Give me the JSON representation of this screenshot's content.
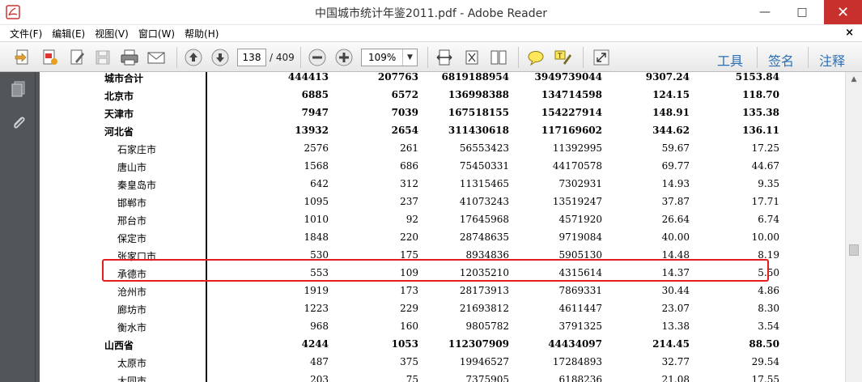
{
  "window": {
    "title": "中国城市统计年鉴2011.pdf - Adobe Reader",
    "minimize": "—",
    "maximize": "□",
    "close": "✕"
  },
  "menu": {
    "items": [
      "文件(F)",
      "编辑(E)",
      "视图(V)",
      "窗口(W)",
      "帮助(H)"
    ],
    "close_doc": "×"
  },
  "toolbar": {
    "page_current": "138",
    "page_total": "/ 409",
    "zoom": "109%",
    "tools_label": "工具",
    "sign_label": "签名",
    "comment_label": "注释",
    "accent_color": "#2a6fb5"
  },
  "table": {
    "rows": [
      {
        "name": "城市合计",
        "bold": true,
        "indent": false,
        "v1": "444413",
        "v2": "207763",
        "v3": "6819188954",
        "v4": "3949739044",
        "v5": "9307.24",
        "v6": "5153.84"
      },
      {
        "name": "北京市",
        "bold": true,
        "indent": false,
        "v1": "6885",
        "v2": "6572",
        "v3": "136998388",
        "v4": "134714598",
        "v5": "124.15",
        "v6": "118.70"
      },
      {
        "name": "天津市",
        "bold": true,
        "indent": false,
        "v1": "7947",
        "v2": "7039",
        "v3": "167518155",
        "v4": "154227914",
        "v5": "148.91",
        "v6": "135.38"
      },
      {
        "name": "河北省",
        "bold": true,
        "indent": false,
        "v1": "13932",
        "v2": "2654",
        "v3": "311430618",
        "v4": "117169602",
        "v5": "344.62",
        "v6": "136.11"
      },
      {
        "name": "石家庄市",
        "bold": false,
        "indent": true,
        "v1": "2576",
        "v2": "261",
        "v3": "56553423",
        "v4": "11392995",
        "v5": "59.67",
        "v6": "17.25"
      },
      {
        "name": "唐山市",
        "bold": false,
        "indent": true,
        "v1": "1568",
        "v2": "686",
        "v3": "75450331",
        "v4": "44170578",
        "v5": "69.77",
        "v6": "44.67"
      },
      {
        "name": "秦皇岛市",
        "bold": false,
        "indent": true,
        "v1": "642",
        "v2": "312",
        "v3": "11315465",
        "v4": "7302931",
        "v5": "14.93",
        "v6": "9.35"
      },
      {
        "name": "邯郸市",
        "bold": false,
        "indent": true,
        "v1": "1095",
        "v2": "237",
        "v3": "41073243",
        "v4": "13519247",
        "v5": "37.87",
        "v6": "17.71"
      },
      {
        "name": "邢台市",
        "bold": false,
        "indent": true,
        "v1": "1010",
        "v2": "92",
        "v3": "17645968",
        "v4": "4571920",
        "v5": "26.64",
        "v6": "6.74"
      },
      {
        "name": "保定市",
        "bold": false,
        "indent": true,
        "v1": "1848",
        "v2": "220",
        "v3": "28748635",
        "v4": "9719084",
        "v5": "40.00",
        "v6": "10.00"
      },
      {
        "name": "张家口市",
        "bold": false,
        "indent": true,
        "v1": "530",
        "v2": "175",
        "v3": "8934836",
        "v4": "5905130",
        "v5": "14.48",
        "v6": "8.19"
      },
      {
        "name": "承德市",
        "bold": false,
        "indent": true,
        "v1": "553",
        "v2": "109",
        "v3": "12035210",
        "v4": "4315614",
        "v5": "14.37",
        "v6": "5.50"
      },
      {
        "name": "沧州市",
        "bold": false,
        "indent": true,
        "v1": "1919",
        "v2": "173",
        "v3": "28173913",
        "v4": "7869331",
        "v5": "30.44",
        "v6": "4.86"
      },
      {
        "name": "廊坊市",
        "bold": false,
        "indent": true,
        "v1": "1223",
        "v2": "229",
        "v3": "21693812",
        "v4": "4611447",
        "v5": "23.07",
        "v6": "8.30"
      },
      {
        "name": "衡水市",
        "bold": false,
        "indent": true,
        "v1": "968",
        "v2": "160",
        "v3": "9805782",
        "v4": "3791325",
        "v5": "13.38",
        "v6": "3.54"
      },
      {
        "name": "山西省",
        "bold": true,
        "indent": false,
        "v1": "4244",
        "v2": "1053",
        "v3": "112307909",
        "v4": "44434097",
        "v5": "214.45",
        "v6": "88.50"
      },
      {
        "name": "太原市",
        "bold": false,
        "indent": true,
        "v1": "487",
        "v2": "375",
        "v3": "19946527",
        "v4": "17284893",
        "v5": "32.77",
        "v6": "29.54"
      },
      {
        "name": "大同市",
        "bold": false,
        "indent": true,
        "v1": "203",
        "v2": "75",
        "v3": "7375905",
        "v4": "6188236",
        "v5": "21.08",
        "v6": "17.55"
      }
    ],
    "highlight_color": "#e41e1e"
  }
}
